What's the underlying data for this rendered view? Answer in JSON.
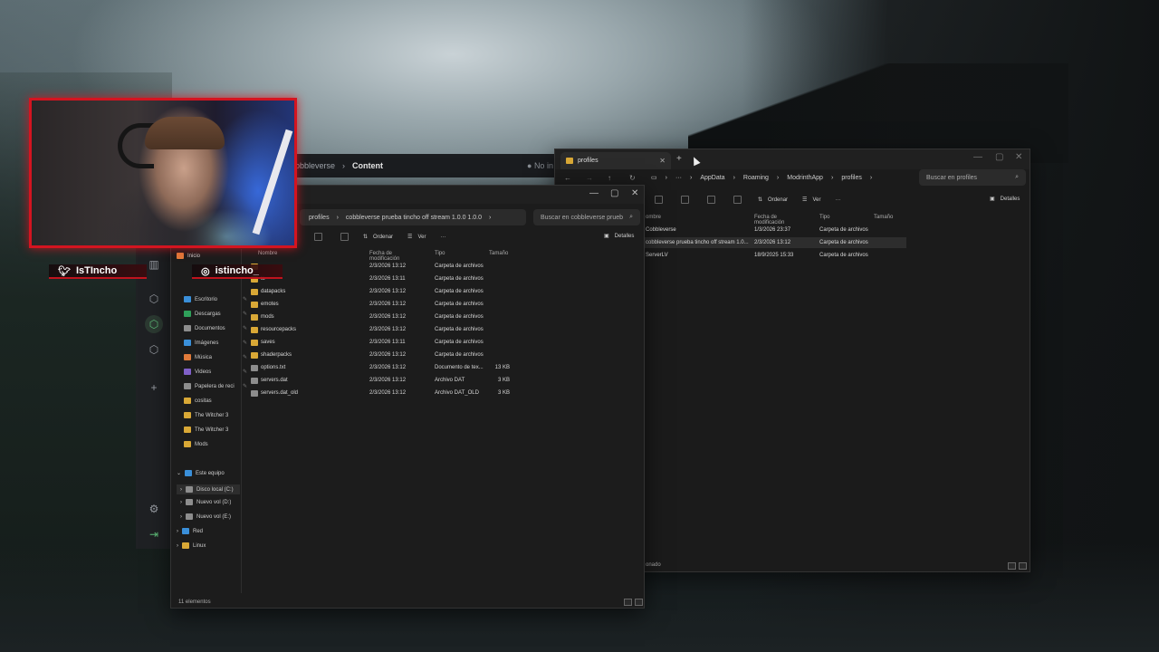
{
  "modrinth": {
    "breadcrumb_parent": "obbleverse",
    "breadcrumb_current": "Content",
    "status_text": "No in"
  },
  "explorer_front": {
    "address": [
      "profiles",
      "cobbleverse prueba tincho off stream 1.0.0 1.0.0"
    ],
    "search_placeholder": "Buscar en cobbleverse prueb",
    "toolbar": {
      "sort": "Ordenar",
      "view": "Ver",
      "more": "···",
      "details": "Detalles"
    },
    "columns": [
      "Nombre",
      "Fecha de modificación",
      "Tipo",
      "Tamaño"
    ],
    "nav": [
      {
        "label": "Inicio",
        "icon": "home-icon"
      },
      {
        "label": "Escritorio",
        "icon": "desktop-folder-icon",
        "pinned": true
      },
      {
        "label": "Descargas",
        "icon": "downloads-icon",
        "pinned": true
      },
      {
        "label": "Documentos",
        "icon": "documents-icon",
        "pinned": true
      },
      {
        "label": "Imágenes",
        "icon": "pictures-icon",
        "pinned": true
      },
      {
        "label": "Música",
        "icon": "music-icon",
        "pinned": true
      },
      {
        "label": "Videos",
        "icon": "videos-icon",
        "pinned": true
      },
      {
        "label": "Papelera de reci",
        "icon": "recycle-bin-icon",
        "pinned": true
      },
      {
        "label": "cositas",
        "icon": "folder-icon"
      },
      {
        "label": "The Witcher 3",
        "icon": "folder-icon"
      },
      {
        "label": "The Witcher 3",
        "icon": "folder-icon"
      },
      {
        "label": "Mods",
        "icon": "folder-icon"
      },
      {
        "label": "Este equipo",
        "icon": "computer-icon"
      },
      {
        "label": "Disco local (C:)",
        "icon": "drive-icon"
      },
      {
        "label": "Nuevo vol (D:)",
        "icon": "drive-icon"
      },
      {
        "label": "Nuevo vol (E:)",
        "icon": "drive-icon"
      },
      {
        "label": "Red",
        "icon": "network-icon"
      },
      {
        "label": "Linux",
        "icon": "linux-icon"
      }
    ],
    "files": [
      {
        "name": "",
        "date": "2/3/2026 13:12",
        "type": "Carpeta de archivos",
        "size": ""
      },
      {
        "name": "ts",
        "date": "2/3/2026 13:11",
        "type": "Carpeta de archivos",
        "size": ""
      },
      {
        "name": "datapacks",
        "date": "2/3/2026 13:12",
        "type": "Carpeta de archivos",
        "size": ""
      },
      {
        "name": "emotes",
        "date": "2/3/2026 13:12",
        "type": "Carpeta de archivos",
        "size": ""
      },
      {
        "name": "mods",
        "date": "2/3/2026 13:12",
        "type": "Carpeta de archivos",
        "size": ""
      },
      {
        "name": "resourcepacks",
        "date": "2/3/2026 13:12",
        "type": "Carpeta de archivos",
        "size": ""
      },
      {
        "name": "saves",
        "date": "2/3/2026 13:11",
        "type": "Carpeta de archivos",
        "size": ""
      },
      {
        "name": "shaderpacks",
        "date": "2/3/2026 13:12",
        "type": "Carpeta de archivos",
        "size": ""
      },
      {
        "name": "options.txt",
        "date": "2/3/2026 13:12",
        "type": "Documento de tex...",
        "size": "13 KB"
      },
      {
        "name": "servers.dat",
        "date": "2/3/2026 13:12",
        "type": "Archivo DAT",
        "size": "3 KB"
      },
      {
        "name": "servers.dat_old",
        "date": "2/3/2026 13:12",
        "type": "Archivo DAT_OLD",
        "size": "3 KB"
      }
    ],
    "status": "11 elementos"
  },
  "explorer_back": {
    "tab_label": "profiles",
    "address": [
      "AppData",
      "Roaming",
      "ModrinthApp",
      "profiles"
    ],
    "search_placeholder": "Buscar en profiles",
    "toolbar": {
      "sort": "Ordenar",
      "view": "Ver",
      "more": "···",
      "details": "Detalles"
    },
    "columns": [
      "ombre",
      "Fecha de modificación",
      "Tipo",
      "Tamaño"
    ],
    "files": [
      {
        "name": "Cobbleverse",
        "date": "1/3/2026 23:37",
        "type": "Carpeta de archivos"
      },
      {
        "name": "cobbleverse prueba tincho off stream 1.0...",
        "date": "2/3/2026 13:12",
        "type": "Carpeta de archivos"
      },
      {
        "name": "ServerLV",
        "date": "18/9/2025 15:33",
        "type": "Carpeta de archivos"
      }
    ],
    "status": "onado"
  },
  "overlay": {
    "twitter_handle": "IsTIncho",
    "instagram_handle": "istincho_"
  },
  "colors": {
    "accent_red": "#d41420",
    "folder_yellow": "#d9a836",
    "explorer_bg": "#1c1c1c"
  }
}
